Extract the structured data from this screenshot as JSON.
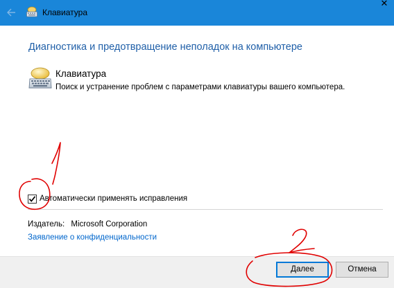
{
  "window": {
    "title": "Клавиатура",
    "close_glyph": "✕",
    "accent_color": "#1a86d9"
  },
  "main": {
    "heading": "Диагностика и предотвращение неполадок на компьютере",
    "item": {
      "icon": "keyboard-icon",
      "title": "Клавиатура",
      "description": "Поиск и устранение проблем с параметрами клавиатуры вашего компьютера."
    },
    "auto_apply": {
      "label": "Автоматически применять исправления",
      "checked": true
    },
    "publisher": {
      "label": "Издатель:",
      "value": "Microsoft Corporation"
    },
    "privacy_link": "Заявление о конфиденциальности"
  },
  "footer": {
    "next_label": "Далее",
    "cancel_label": "Отмена"
  },
  "annotations": {
    "color": "#e00000",
    "marks": [
      "1",
      "2"
    ]
  }
}
